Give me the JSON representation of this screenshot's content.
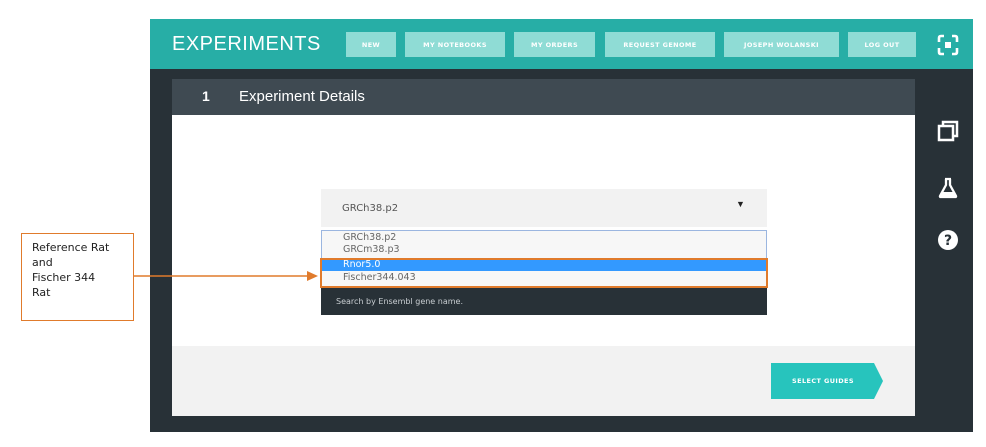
{
  "annotation": {
    "lines": [
      "Reference Rat",
      "and",
      "Fischer 344",
      "Rat"
    ]
  },
  "header": {
    "title": "EXPERIMENTS",
    "nav": [
      "NEW",
      "MY NOTEBOOKS",
      "MY ORDERS",
      "REQUEST GENOME",
      "JOSEPH WOLANSKI",
      "LOG OUT"
    ],
    "accent_color": "#27aea6",
    "nav_button_color": "#8fdcd5"
  },
  "sidebar": {
    "icons": [
      "copy-icon",
      "flask-icon",
      "help-icon"
    ]
  },
  "step": {
    "number": "1",
    "title": "Experiment Details"
  },
  "genome_select": {
    "value": "GRCh38.p2",
    "options": [
      "GRCh38.p2",
      "GRCm38.p3",
      "Rnor5.0",
      "Fischer344.043"
    ],
    "highlighted_option": "Rnor5.0"
  },
  "search": {
    "placeholder": "Search by Ensembl gene name."
  },
  "footer": {
    "select_guides_label": "SELECT GUIDES"
  }
}
